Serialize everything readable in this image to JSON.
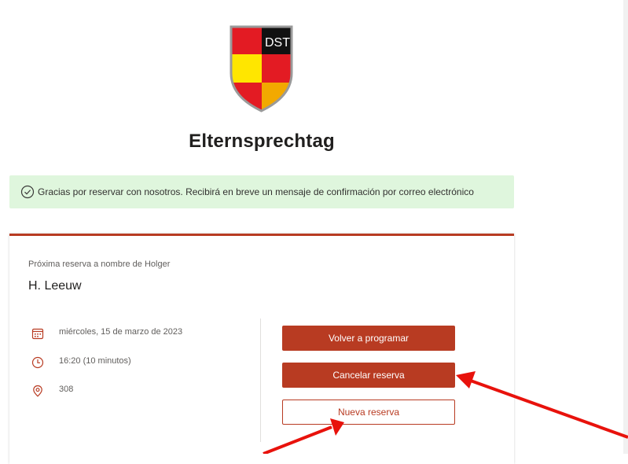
{
  "logo": {
    "text": "DST"
  },
  "page": {
    "title": "Elternsprechtag"
  },
  "banner": {
    "message": "Gracias por reservar con nosotros. Recibirá en breve un mensaje de confirmación por correo electrónico"
  },
  "booking": {
    "label": "Próxima reserva a nombre de Holger",
    "name": "H. Leeuw",
    "date": "miércoles, 15 de marzo de 2023",
    "time": "16:20 (10 minutos)",
    "location": "308"
  },
  "actions": {
    "reschedule": "Volver a programar",
    "cancel": "Cancelar reserva",
    "new": "Nueva reserva"
  },
  "colors": {
    "accent": "#b83b22",
    "banner_bg": "#dff6dd",
    "annotation_arrow": "#e8120c"
  },
  "icons": {
    "banner": "check-circle-icon",
    "date": "calendar-icon",
    "time": "clock-icon",
    "location": "location-pin-icon"
  }
}
